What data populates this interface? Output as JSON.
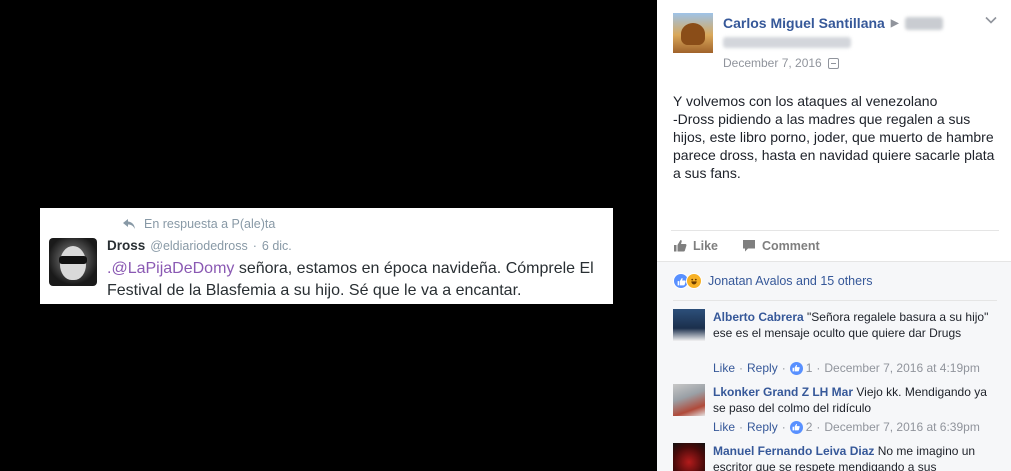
{
  "tweet": {
    "reply_to": "En respuesta a P(ale)ta",
    "name": "Dross",
    "handle": "@eldiariodedross",
    "separator": "·",
    "date": "6 dic.",
    "mention": ".@LaPijaDeDomy",
    "text": " señora, estamos en época navideña. Cómprele El Festival de la Blasfemia a su hijo. Sé que le va a encantar."
  },
  "post": {
    "author": "Carlos Miguel Santillana",
    "arrow": "▶",
    "date": "December 7, 2016",
    "body": "Y volvemos con los ataques al venezolano\n-Dross pidiendo a las madres que regalen a sus hijos, este libro porno, joder, que muerto de hambre parece dross, hasta en navidad quiere sacarle plata a sus fans.",
    "like_label": "Like",
    "comment_label": "Comment"
  },
  "reactions": {
    "summary": "Jonatan Avalos and 15 others"
  },
  "comments": [
    {
      "name": "Alberto Cabrera",
      "text": " \"Señora regalele basura a su hijo\" ese es el mensaje oculto que quiere dar Drugs",
      "like": "Like",
      "reply": "Reply",
      "likes": "1",
      "date": "December 7, 2016 at 4:19pm"
    },
    {
      "name": "Lkonker Grand Z LH Mar",
      "text": " Viejo kk. Mendigando ya se paso del colmo del ridículo",
      "like": "Like",
      "reply": "Reply",
      "likes": "2",
      "date": "December 7, 2016 at 6:39pm"
    },
    {
      "name": "Manuel Fernando Leiva Diaz",
      "text": " No me imagino un escritor que se respete mendigando a sus"
    }
  ],
  "meta_separator": "·",
  "colors": {
    "fb_link": "#365899",
    "twitter_mention": "#8a59b3",
    "like_blue": "#5890ff"
  },
  "icons": [
    "reply-arrow-icon",
    "thumbs-up-icon",
    "comment-bubble-icon",
    "globe-icon",
    "chevron-down-icon",
    "haha-reaction-icon",
    "like-reaction-icon"
  ]
}
